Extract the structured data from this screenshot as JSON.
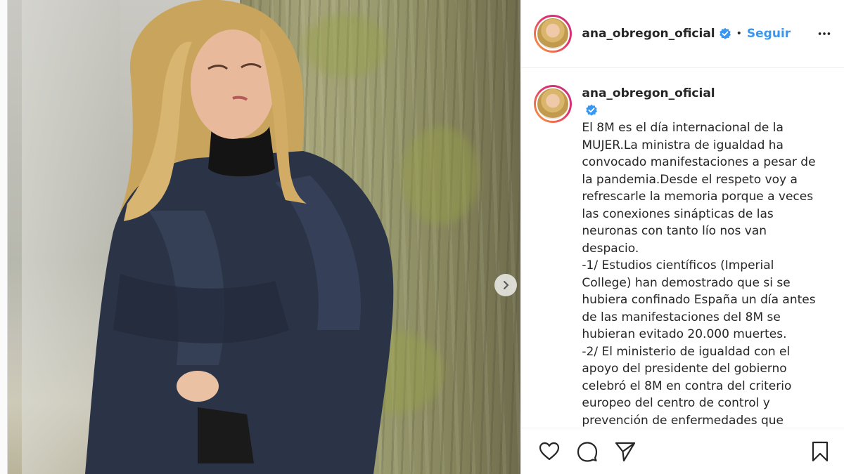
{
  "post": {
    "author": {
      "username": "ana_obregon_oficial",
      "verified": true
    },
    "header": {
      "separator": "•",
      "follow_label": "Seguir"
    },
    "caption": {
      "username": "ana_obregon_oficial",
      "text": "El 8M es el día internacional de la MUJER.La ministra de igualdad ha convocado manifestaciones a pesar de la pandemia.Desde el respeto voy a refrescarle la memoria porque a veces las conexiones sinápticas de las neuronas con tanto lío nos van despacio.\n-1/ Estudios científicos (Imperial College) han demostrado que si se hubiera confinado España un día antes de las manifestaciones del 8M se hubieran evitado 20.000 muertes.\n-2/ El ministerio de igualdad con el apoyo del presidente del gobierno celebró el 8M en contra del criterio europeo del centro de control y prevención de enfermedades que"
    },
    "icons": {
      "verified": "verified-badge-icon",
      "more": "more-options-icon",
      "next": "chevron-right-icon",
      "like": "heart-icon",
      "comment": "comment-icon",
      "share": "paper-plane-icon",
      "save": "bookmark-icon"
    },
    "colors": {
      "accent": "#3897f0",
      "verified": "#3897f0",
      "text": "#262626",
      "border": "#efefef"
    }
  }
}
